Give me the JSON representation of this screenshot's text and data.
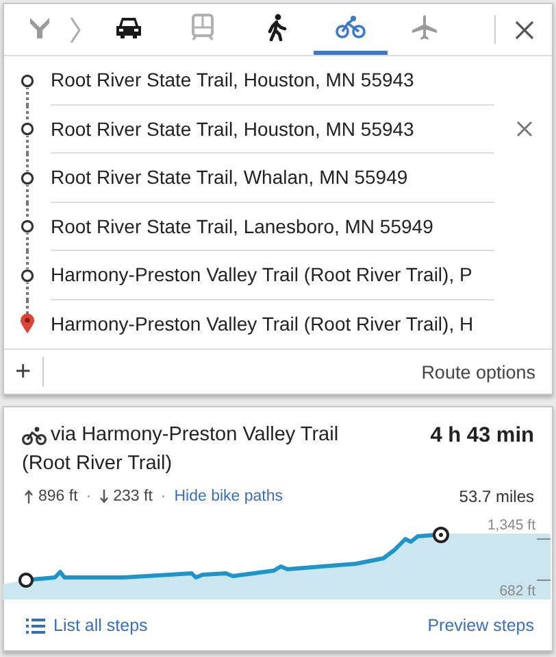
{
  "modes": [
    {
      "kind": "route",
      "selected": false
    },
    {
      "kind": "car",
      "selected": false
    },
    {
      "kind": "transit",
      "selected": false
    },
    {
      "kind": "walk",
      "selected": false
    },
    {
      "kind": "bike",
      "selected": true
    },
    {
      "kind": "plane",
      "selected": false
    }
  ],
  "waypoints": [
    {
      "text": "Root River State Trail, Houston, MN 55943",
      "kind": "stop",
      "hovered": false
    },
    {
      "text": "Root River State Trail, Houston, MN 55943",
      "kind": "stop",
      "hovered": true
    },
    {
      "text": "Root River State Trail, Whalan, MN 55949",
      "kind": "stop",
      "hovered": false
    },
    {
      "text": "Root River State Trail, Lanesboro, MN 55949",
      "kind": "stop",
      "hovered": false
    },
    {
      "text": "Harmony-Preston Valley Trail (Root River Trail), P",
      "kind": "stop",
      "hovered": false
    },
    {
      "text": "Harmony-Preston Valley Trail (Root River Trail), H",
      "kind": "destination",
      "hovered": false
    }
  ],
  "add_stop": "+",
  "route_options": "Route options",
  "route": {
    "title": "via Harmony-Preston Valley Trail (Root River Trail)",
    "duration": "4 h 43 min",
    "climb": "896 ft",
    "descent": "233 ft",
    "separator": "·",
    "link": "Hide bike paths",
    "distance": "53.7 miles",
    "elevation": {
      "max_label": "1,345 ft",
      "min_label": "682 ft"
    }
  },
  "footer": {
    "list_steps": "List all steps",
    "preview_steps": "Preview steps"
  }
}
